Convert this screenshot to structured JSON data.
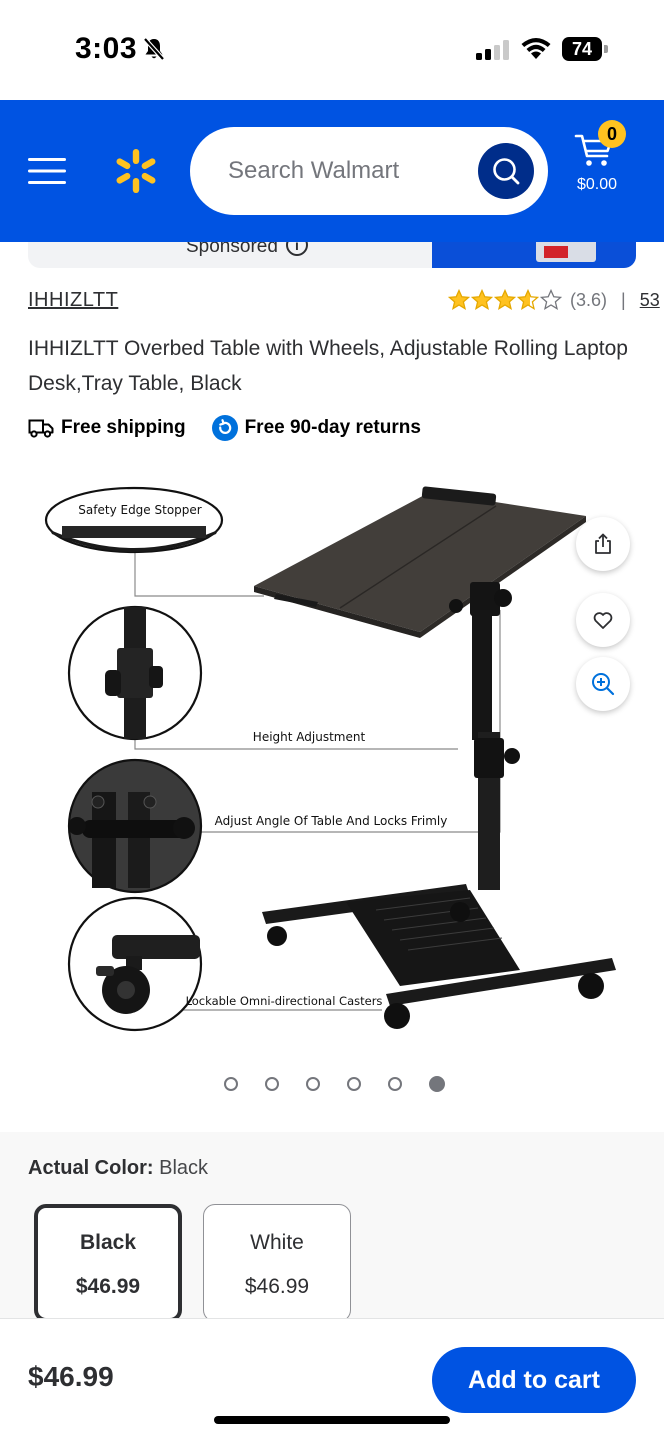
{
  "status_bar": {
    "time": "3:03",
    "battery": "74"
  },
  "header": {
    "search": {
      "placeholder": "Search Walmart"
    },
    "cart": {
      "count": "0",
      "total": "$0.00"
    },
    "colors": {
      "brand_blue": "#0053e2",
      "spark_yellow": "#ffc220"
    }
  },
  "sponsored": {
    "label": "Sponsored",
    "info_glyph": "i"
  },
  "product": {
    "brand": "IHHIZLTT",
    "rating": {
      "stars": 3.6,
      "value_text": "(3.6)",
      "separator": "|",
      "review_count": "53"
    },
    "title": "IHHIZLTT Overbed Table with Wheels, Adjustable Rolling Laptop Desk,Tray Table, Black",
    "badges": {
      "shipping": "Free shipping",
      "returns": "Free 90-day returns"
    }
  },
  "gallery": {
    "callouts": {
      "stopper": "Safety Edge Stopper",
      "height": "Height Adjustment",
      "angle": "Adjust Angle Of Table And Locks Frimly",
      "casters": "Lockable Omni-directional Casters"
    },
    "image_count": 6,
    "active_index": 5
  },
  "variant": {
    "label": "Actual Color:",
    "value": "Black",
    "options": [
      {
        "name": "Black",
        "price": "$46.99",
        "selected": true
      },
      {
        "name": "White",
        "price": "$46.99",
        "selected": false
      }
    ]
  },
  "bottom_bar": {
    "price": "$46.99",
    "add_to_cart": "Add to cart"
  }
}
